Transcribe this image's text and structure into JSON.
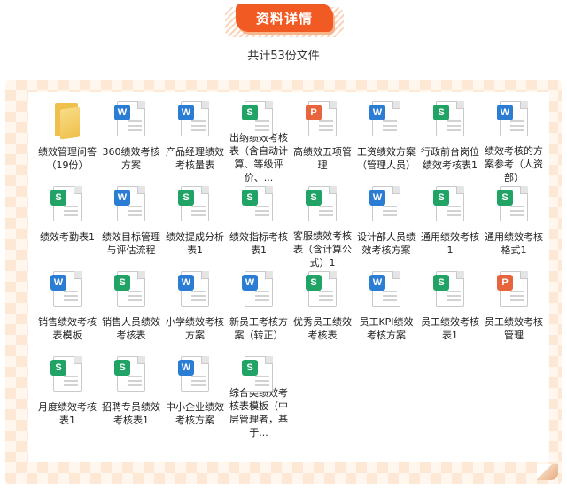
{
  "header": {
    "title": "资料详情",
    "subtitle": "共计53份文件"
  },
  "colors": {
    "accent": "#f15a22",
    "word": "#2b7cd3",
    "sheet": "#21a366",
    "ppt": "#e8643c",
    "folder": "#efc04c"
  },
  "icon_types": {
    "folder": {
      "name": "folder-icon",
      "glyph": ""
    },
    "word": {
      "name": "word-document-icon",
      "glyph": "W"
    },
    "sheet": {
      "name": "spreadsheet-document-icon",
      "glyph": "S"
    },
    "ppt": {
      "name": "presentation-document-icon",
      "glyph": "P"
    }
  },
  "files": [
    {
      "label": "绩效管理问答（19份）",
      "type": "folder"
    },
    {
      "label": "360绩效考核方案",
      "type": "word"
    },
    {
      "label": "产品经理绩效考核量表",
      "type": "word"
    },
    {
      "label": "出纳绩效考核表（含自动计算、等级评价、...",
      "type": "sheet"
    },
    {
      "label": "高绩效五项管理",
      "type": "ppt"
    },
    {
      "label": "工资绩效方案（管理人员）",
      "type": "word"
    },
    {
      "label": "行政前台岗位绩效考核表1",
      "type": "sheet"
    },
    {
      "label": "绩效考核的方案参考（人资部）",
      "type": "word"
    },
    {
      "label": "绩效考勤表1",
      "type": "sheet"
    },
    {
      "label": "绩效目标管理与评估流程",
      "type": "word"
    },
    {
      "label": "绩效提成分析表1",
      "type": "sheet"
    },
    {
      "label": "绩效指标考核表1",
      "type": "sheet"
    },
    {
      "label": "客服绩效考核表（含计算公式）1",
      "type": "sheet"
    },
    {
      "label": "设计部人员绩效考核方案",
      "type": "word"
    },
    {
      "label": "通用绩效考核1",
      "type": "sheet"
    },
    {
      "label": "通用绩效考核格式1",
      "type": "sheet"
    },
    {
      "label": "销售绩效考核表模板",
      "type": "word"
    },
    {
      "label": "销售人员绩效考核表",
      "type": "sheet"
    },
    {
      "label": "小学绩效考核方案",
      "type": "word"
    },
    {
      "label": "新员工考核方案（转正）",
      "type": "word"
    },
    {
      "label": "优秀员工绩效考核表",
      "type": "sheet"
    },
    {
      "label": "员工KPI绩效考核方案",
      "type": "word"
    },
    {
      "label": "员工绩效考核表1",
      "type": "sheet"
    },
    {
      "label": "员工绩效考核管理",
      "type": "ppt"
    },
    {
      "label": "月度绩效考核表1",
      "type": "sheet"
    },
    {
      "label": "招聘专员绩效考核表1",
      "type": "sheet"
    },
    {
      "label": "中小企业绩效考核方案",
      "type": "word"
    },
    {
      "label": "综合类绩效考核表模板（中层管理者，基于...",
      "type": "sheet"
    }
  ]
}
